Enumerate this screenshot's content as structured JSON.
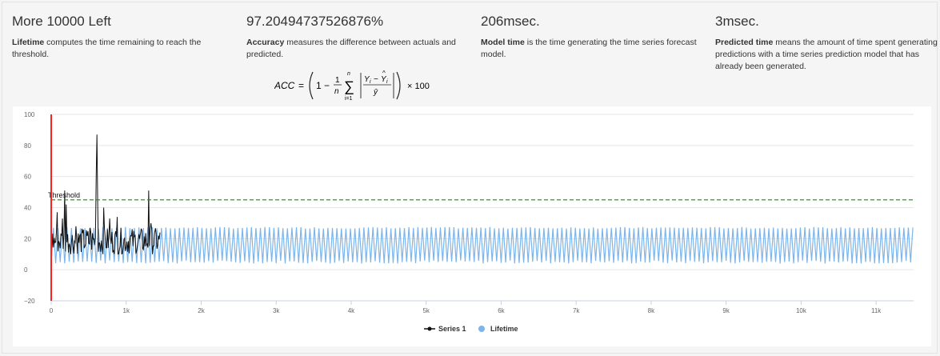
{
  "metrics": [
    {
      "value": "More 10000 Left",
      "term": "Lifetime",
      "description": " computes the time remaining to reach the threshold."
    },
    {
      "value": "97.20494737526876%",
      "term": "Accuracy",
      "description": " measures the difference between actuals and predicted."
    },
    {
      "value": "206msec.",
      "term": "Model time",
      "description": " is the time generating the time series forecast model."
    },
    {
      "value": "3msec.",
      "term": "Predicted time",
      "description": " means the amount of time spent generating predictions with a time series prediction model that has already been generated."
    }
  ],
  "formula": {
    "lhs": "ACC",
    "one": "1",
    "n": "n",
    "i1": "i=1",
    "y_term": "Y",
    "y_sub": "i",
    "ybar": "ȳ",
    "times100": "× 100"
  },
  "chart_data": {
    "type": "line",
    "xlim": [
      0,
      11500
    ],
    "ylim": [
      -20,
      100
    ],
    "x_ticks": [
      0,
      1000,
      2000,
      3000,
      4000,
      5000,
      6000,
      7000,
      8000,
      9000,
      10000,
      11000
    ],
    "x_tick_labels": [
      "0",
      "1k",
      "2k",
      "3k",
      "4k",
      "5k",
      "6k",
      "7k",
      "8k",
      "9k",
      "10k",
      "11k"
    ],
    "y_ticks": [
      -20,
      0,
      20,
      40,
      60,
      80,
      100
    ],
    "y_tick_labels": [
      "−20",
      "0",
      "20",
      "40",
      "60",
      "80",
      "100"
    ],
    "grid": true,
    "legend_position": "bottom-center",
    "threshold": {
      "label": "Threshold",
      "value": 45,
      "color": "#1a8a1a"
    },
    "current_marker": {
      "x": 0,
      "color": "#ff2020"
    },
    "series": [
      {
        "name": "Series 1",
        "color": "#111111",
        "x_range": [
          0,
          1450
        ],
        "baseline_range": [
          10,
          27
        ],
        "spikes": [
          {
            "x": 80,
            "y": 37
          },
          {
            "x": 150,
            "y": 33
          },
          {
            "x": 175,
            "y": 51
          },
          {
            "x": 200,
            "y": 42
          },
          {
            "x": 330,
            "y": 28
          },
          {
            "x": 520,
            "y": 27
          },
          {
            "x": 600,
            "y": 60
          },
          {
            "x": 610,
            "y": 87
          },
          {
            "x": 620,
            "y": 42
          },
          {
            "x": 700,
            "y": 40
          },
          {
            "x": 780,
            "y": 33
          },
          {
            "x": 880,
            "y": 34
          },
          {
            "x": 1300,
            "y": 51
          },
          {
            "x": 1330,
            "y": 30
          }
        ]
      },
      {
        "name": "Lifetime",
        "color": "#7cb5ec",
        "x_range": [
          0,
          11500
        ],
        "oscillation": {
          "min": 5,
          "max": 27,
          "period": 60
        }
      }
    ]
  }
}
